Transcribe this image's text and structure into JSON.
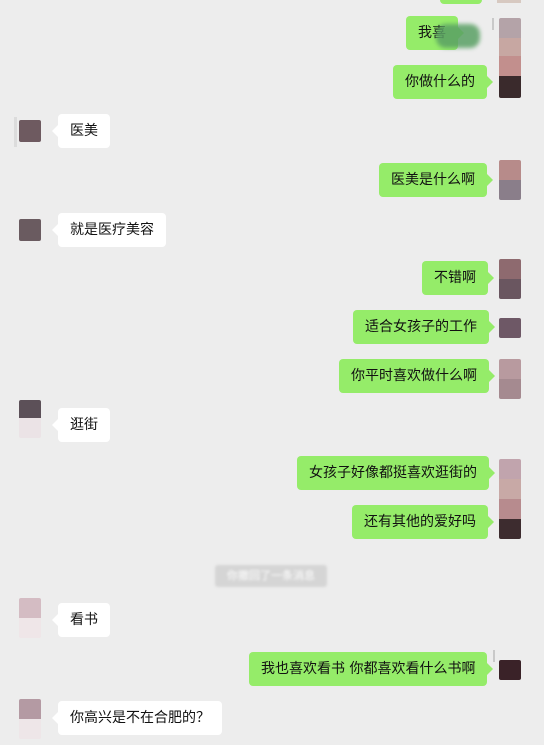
{
  "colors": {
    "background": "#ededed",
    "outgoing_bubble": "#95ec69",
    "incoming_bubble": "#ffffff",
    "system_notice_bg": "#d5d5d5"
  },
  "messages": [
    {
      "id": "m1",
      "side": "right",
      "text": "我喜"
    },
    {
      "id": "m2",
      "side": "right",
      "text": "你做什么的"
    },
    {
      "id": "m3",
      "side": "left",
      "text": "医美"
    },
    {
      "id": "m4",
      "side": "right",
      "text": "医美是什么啊"
    },
    {
      "id": "m5",
      "side": "left",
      "text": "就是医疗美容"
    },
    {
      "id": "m6",
      "side": "right",
      "text": "不错啊"
    },
    {
      "id": "m7",
      "side": "right",
      "text": "适合女孩子的工作"
    },
    {
      "id": "m8",
      "side": "right",
      "text": "你平时喜欢做什么啊"
    },
    {
      "id": "m9",
      "side": "left",
      "text": "逛街"
    },
    {
      "id": "m10",
      "side": "right",
      "text": "女孩子好像都挺喜欢逛街的"
    },
    {
      "id": "m11",
      "side": "right",
      "text": "还有其他的爱好吗"
    },
    {
      "id": "m12",
      "side": "left",
      "text": "看书"
    },
    {
      "id": "m13",
      "side": "right",
      "text": "我也喜欢看书 你都喜欢看什么书啊"
    },
    {
      "id": "m14",
      "side": "left",
      "text": "你高兴是不在合肥的？"
    }
  ],
  "system_notice": {
    "text": "你撤回了一条消息"
  }
}
